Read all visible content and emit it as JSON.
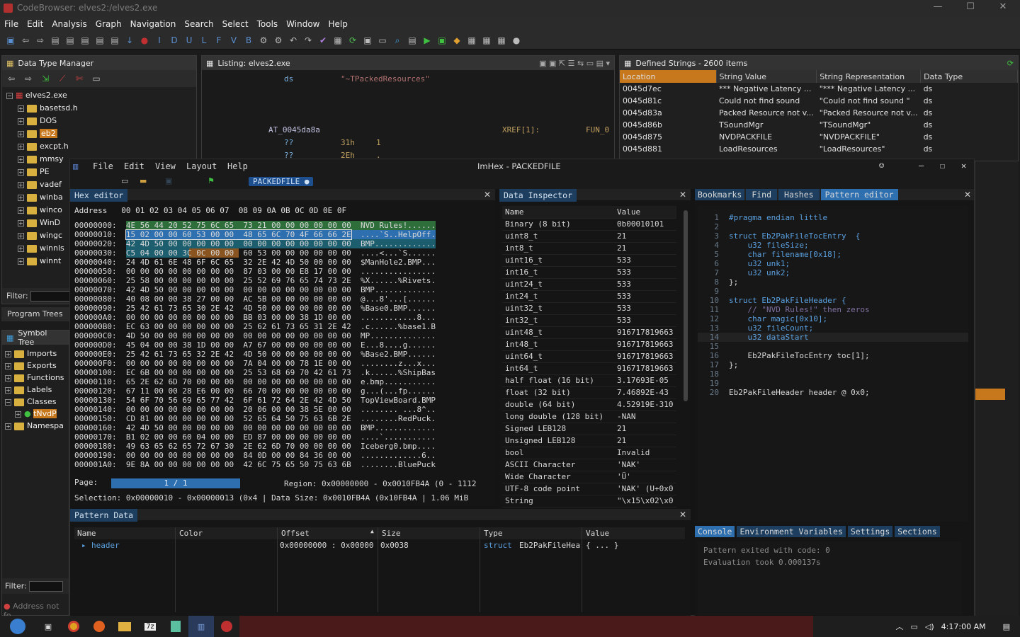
{
  "window": {
    "title": "CodeBrowser: elves2:/elves2.exe"
  },
  "menu": [
    "File",
    "Edit",
    "Analysis",
    "Graph",
    "Navigation",
    "Search",
    "Select",
    "Tools",
    "Window",
    "Help"
  ],
  "toolbar_letters": [
    "I",
    "D",
    "U",
    "L",
    "F",
    "V",
    "B"
  ],
  "dtm": {
    "title": "Data Type Manager",
    "root": "elves2.exe",
    "items": [
      "basetsd.h",
      "DOS",
      "eb2",
      "excpt.h",
      "mmsy",
      "PE",
      "vadef",
      "winba",
      "winco",
      "WinD",
      "wingc",
      "winnls",
      "winnt"
    ],
    "filter_label": "Filter:"
  },
  "program_trees": "Program Trees",
  "symbol_tree": {
    "title": "Symbol Tree",
    "items": [
      "Imports",
      "Exports",
      "Functions",
      "Labels",
      "Classes",
      "Namespa"
    ],
    "child": "tNvdP",
    "filter_label": "Filter:",
    "address_placeholder": "Address not fo"
  },
  "listing": {
    "title": "Listing:  elves2.exe",
    "line1_mn": "ds",
    "line1_val": "\"~TPackedResources\"",
    "label": "AT_0045da8a",
    "xref": "XREF[1]:",
    "fun": "FUN_0",
    "l3a": "??",
    "l3b": "31h",
    "l3c": "1",
    "l4a": "??",
    "l4b": "2Eh",
    "l4c": "."
  },
  "defined_strings": {
    "title": "Defined Strings - 2600 items",
    "columns": [
      "Location",
      "String Value",
      "String Representation",
      "Data Type"
    ],
    "rows": [
      [
        "0045d7ec",
        "*** Negative Latency ...",
        "\"*** Negative Latency ...",
        "ds"
      ],
      [
        "0045d81c",
        "Could not find sound",
        "\"Could not find sound \"",
        "ds"
      ],
      [
        "0045d83a",
        "Packed Resource not v...",
        "\"Packed Resource not v...",
        "ds"
      ],
      [
        "0045d86b",
        "TSoundMgr",
        "\"TSoundMgr\"",
        "ds"
      ],
      [
        "0045d875",
        "NVDPACKFILE",
        "\"NVDPACKFILE\"",
        "ds"
      ],
      [
        "0045d881",
        "LoadResources",
        "\"LoadResources\"",
        "ds"
      ]
    ]
  },
  "imhex": {
    "menu": [
      "File",
      "Edit",
      "View",
      "Layout",
      "Help"
    ],
    "title": "ImHex - PACKEDFILE",
    "tab": "PACKEDFILE",
    "hex_editor": {
      "title": "Hex editor",
      "header": "Address   00 01 02 03 04 05 06 07  08 09 0A 0B 0C 0D 0E 0F",
      "lines": [
        [
          "00000000:",
          "4E 56 44 20 52 75 6C 65  73 21 00 00 00 00 00 00",
          "NVD Rules!......"
        ],
        [
          "00000010:",
          "15 02 00 00 60 53 00 00  48 65 6C 70 4F 66 66 2E",
          "....`S..HelpOff."
        ],
        [
          "00000020:",
          "42 4D 50 00 00 00 00 00  00 00 00 00 00 00 00 00",
          "BMP............."
        ],
        [
          "00000030:",
          "C5 04 00 00 3C 0C 00 00  60 53 00 00 00 00 00 00",
          "....<...`S......"
        ],
        [
          "00000040:",
          "24 4D 61 6E 48 6F 6C 65  32 2E 42 4D 50 00 00 00",
          "$ManHole2.BMP..."
        ],
        [
          "00000050:",
          "00 00 00 00 00 00 00 00  87 03 00 00 E8 17 00 00",
          "................"
        ],
        [
          "00000060:",
          "25 58 00 00 00 00 00 00  25 52 69 76 65 74 73 2E",
          "%X......%Rivets."
        ],
        [
          "00000070:",
          "42 4D 50 00 00 00 00 00  00 00 00 00 00 00 00 00",
          "BMP............."
        ],
        [
          "00000080:",
          "40 08 00 00 38 27 00 00  AC 5B 00 00 00 00 00 00",
          "@...8'...[......"
        ],
        [
          "00000090:",
          "25 42 61 73 65 30 2E 42  4D 50 00 00 00 00 00 00",
          "%Base0.BMP......"
        ],
        [
          "000000A0:",
          "00 00 00 00 00 00 00 00  BB 03 00 00 38 1D 00 00",
          "............8..."
        ],
        [
          "000000B0:",
          "EC 63 00 00 00 00 00 00  25 62 61 73 65 31 2E 42",
          ".c......%base1.B"
        ],
        [
          "000000C0:",
          "4D 50 00 00 00 00 00 00  00 00 00 00 00 00 00 00",
          "MP.............."
        ],
        [
          "000000D0:",
          "45 04 00 00 38 1D 00 00  A7 67 00 00 00 00 00 00",
          "E...8....g......"
        ],
        [
          "000000E0:",
          "25 42 61 73 65 32 2E 42  4D 50 00 00 00 00 00 00",
          "%Base2.BMP......"
        ],
        [
          "000000F0:",
          "00 00 00 00 00 00 00 00  7A 04 00 00 78 1E 00 00",
          "........z...x..."
        ],
        [
          "00000100:",
          "EC 6B 00 00 00 00 00 00  25 53 68 69 70 42 61 73",
          ".k......%ShipBas"
        ],
        [
          "00000110:",
          "65 2E 62 6D 70 00 00 00  00 00 00 00 00 00 00 00",
          "e.bmp..........."
        ],
        [
          "00000120:",
          "67 11 00 00 28 E6 00 00  66 70 00 00 00 00 00 00",
          "g...(...fp......"
        ],
        [
          "00000130:",
          "54 6F 70 56 69 65 77 42  6F 61 72 64 2E 42 4D 50",
          "TopViewBoard.BMP"
        ],
        [
          "00000140:",
          "00 00 00 00 00 00 00 00  20 06 00 00 38 5E 00 00",
          "........ ...8^.."
        ],
        [
          "00000150:",
          "CD 81 00 00 00 00 00 00  52 65 64 50 75 63 6B 2E",
          "........RedPuck."
        ],
        [
          "00000160:",
          "42 4D 50 00 00 00 00 00  00 00 00 00 00 00 00 00",
          "BMP............."
        ],
        [
          "00000170:",
          "B1 02 00 00 60 04 00 00  ED 87 00 00 00 00 00 00",
          "....`..........."
        ],
        [
          "00000180:",
          "49 63 65 62 65 72 67 30  2E 62 6D 70 00 00 00 00",
          "Iceberg0.bmp...."
        ],
        [
          "00000190:",
          "00 00 00 00 00 00 00 00  84 0D 00 00 84 36 00 00",
          ".............6.."
        ],
        [
          "000001A0:",
          "9E 8A 00 00 00 00 00 00  42 6C 75 65 50 75 63 6B",
          "........BluePuck"
        ]
      ],
      "page_label": "Page:",
      "page_value": "1 / 1",
      "region": "Region: 0x00000000 - 0x0010FB4A (0 - 1112",
      "selection": "Selection: 0x00000010 - 0x00000013 (0x4 | Data Size: 0x0010FB4A (0x10FB4A | 1.06 MiB"
    },
    "inspector": {
      "title": "Data Inspector",
      "columns": [
        "Name",
        "Value"
      ],
      "rows": [
        [
          "Binary (8 bit)",
          "0b00010101"
        ],
        [
          "uint8_t",
          "21"
        ],
        [
          "int8_t",
          "21"
        ],
        [
          "uint16_t",
          "533"
        ],
        [
          "int16_t",
          "533"
        ],
        [
          "uint24_t",
          "533"
        ],
        [
          "int24_t",
          "533"
        ],
        [
          "uint32_t",
          "533"
        ],
        [
          "int32_t",
          "533"
        ],
        [
          "uint48_t",
          "916717819663"
        ],
        [
          "int48_t",
          "916717819663"
        ],
        [
          "uint64_t",
          "916717819663"
        ],
        [
          "int64_t",
          "916717819663"
        ],
        [
          "half float (16 bit)",
          "3.17693E-05"
        ],
        [
          "float (32 bit)",
          "7.46892E-43"
        ],
        [
          "double (64 bit)",
          "4.52919E-310"
        ],
        [
          "long double (128 bit)",
          "-NAN"
        ],
        [
          "Signed LEB128",
          "21"
        ],
        [
          "Unsigned LEB128",
          "21"
        ],
        [
          "bool",
          "Invalid"
        ],
        [
          "ASCII Character",
          "'NAK'"
        ],
        [
          "Wide Character",
          "'Ü'"
        ],
        [
          "UTF-8 code point",
          "'NAK' (U+0x0"
        ],
        [
          "String",
          "\"\\x15\\x02\\x0"
        ]
      ]
    },
    "right_tabs": [
      "Bookmarks",
      "Find",
      "Hashes",
      "Pattern editor"
    ],
    "pattern_code": [
      "#pragma endian little",
      "",
      "struct Eb2PakFileTocEntry  {",
      "    u32 fileSize;",
      "    char filename[0x18];",
      "    u32 unk1;",
      "    u32 unk2;",
      "};",
      "",
      "struct Eb2PakFileHeader {",
      "    // \"NVD Rules!\" then zeros",
      "    char magic[0x10];",
      "    u32 fileCount;",
      "    u32 dataStart",
      "",
      "    Eb2PakFileTocEntry toc[1];",
      "};",
      "",
      "",
      "Eb2PakFileHeader header @ 0x0;"
    ],
    "console_tabs": [
      "Console",
      "Environment Variables",
      "Settings",
      "Sections"
    ],
    "console_lines": [
      "Pattern exited with code: 0",
      "Evaluation took 0.000137s"
    ],
    "pattern_data": {
      "title": "Pattern Data",
      "columns": [
        "Name",
        "Color",
        "Offset",
        "Size",
        "Type",
        "Value"
      ],
      "row": {
        "name": "header",
        "offset": "0x00000000 : 0x00000",
        "size": "0x0038",
        "type_kw": "struct",
        "type": "Eb2PakFileHea",
        "value": "{ ... }"
      }
    }
  },
  "taskbar": {
    "clock": "4:17:00 AM"
  },
  "colors": {
    "accent": "#1d3e5e",
    "selection": "#2e6fb0",
    "orange": "#c8781c",
    "green_hl": "#2d6e3a"
  }
}
